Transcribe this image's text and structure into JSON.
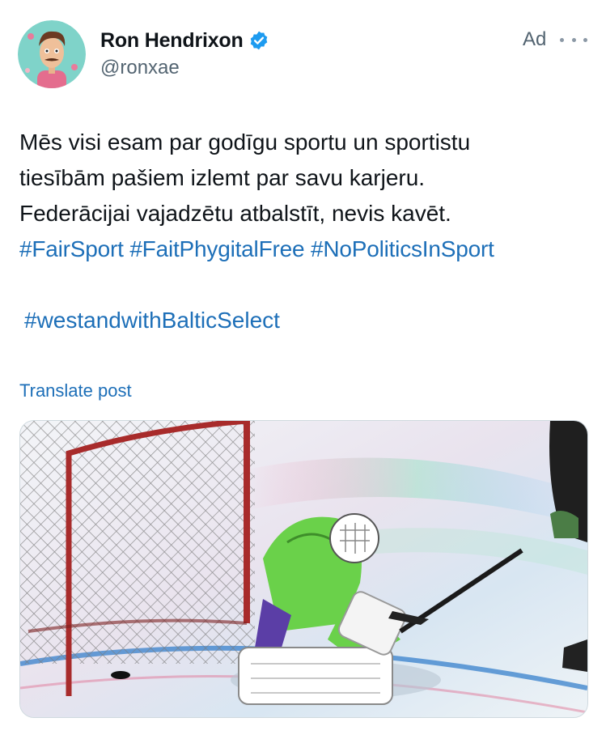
{
  "author": {
    "display_name": "Ron Hendrixon",
    "handle": "@ronxae",
    "verified": true,
    "avatar_icon": "cartoon-avatar-icon"
  },
  "ad_label": "Ad",
  "more_icon": "more-horizontal-icon",
  "post": {
    "lines": [
      "Mēs visi esam par godīgu sportu un sportistu",
      "tiesībām pašiem izlemt par savu karjeru.",
      "Federācijai vajadzētu atbalstīt, nevis kavēt."
    ],
    "hashtags": [
      "#FairSport",
      "#FaitPhygitalFree",
      "#NoPoliticsInSport"
    ],
    "hashtag_2": "#westandwithBalticSelect"
  },
  "translate_label": "Translate post",
  "media": {
    "description_icon": "hockey-goalie-photo"
  },
  "colors": {
    "link": "#1d6fb8",
    "verified": "#1d9bf0",
    "secondary_text": "#536471"
  }
}
